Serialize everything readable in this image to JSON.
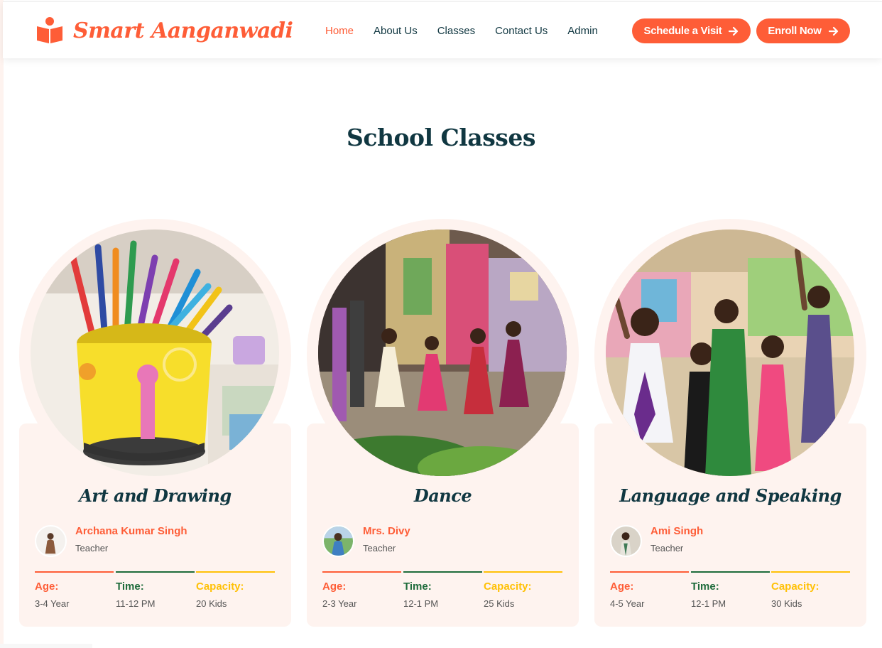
{
  "brand": {
    "name": "Smart Aanganwadi",
    "icon": "book-reader-icon",
    "color": "#fe5d37"
  },
  "nav": {
    "items": [
      {
        "label": "Home",
        "active": true
      },
      {
        "label": "About Us",
        "active": false
      },
      {
        "label": "Classes",
        "active": false
      },
      {
        "label": "Contact Us",
        "active": false
      },
      {
        "label": "Admin",
        "active": false
      }
    ]
  },
  "buttons": {
    "schedule_visit": "Schedule a Visit",
    "enroll_now": "Enroll Now",
    "icon": "arrow-right-icon"
  },
  "section": {
    "title": "School Classes"
  },
  "colors": {
    "accent": "#fe5d37",
    "green": "#1e6b3b",
    "yellow": "#ffc107",
    "dark": "#103741",
    "card_bg": "#fef3ef"
  },
  "classes": [
    {
      "title": "Art and Drawing",
      "photo": "pencil-cup-photo",
      "teacher": {
        "name": "Archana Kumar Singh",
        "role": "Teacher"
      },
      "age_label": "Age:",
      "age": "3-4 Year",
      "time_label": "Time:",
      "time": "11-12 PM",
      "capacity_label": "Capacity:",
      "capacity": "20 Kids"
    },
    {
      "title": "Dance",
      "photo": "children-dancing-photo",
      "teacher": {
        "name": "Mrs. Divy",
        "role": "Teacher"
      },
      "age_label": "Age:",
      "age": "2-3 Year",
      "time_label": "Time:",
      "time": "12-1 PM",
      "capacity_label": "Capacity:",
      "capacity": "25 Kids"
    },
    {
      "title": "Language and Speaking",
      "photo": "children-raising-hands-photo",
      "teacher": {
        "name": "Ami Singh",
        "role": "Teacher"
      },
      "age_label": "Age:",
      "age": "4-5 Year",
      "time_label": "Time:",
      "time": "12-1 PM",
      "capacity_label": "Capacity:",
      "capacity": "30 Kids"
    }
  ]
}
